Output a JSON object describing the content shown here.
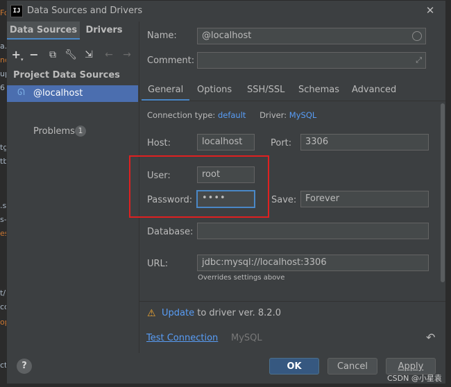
{
  "window": {
    "title": "Data Sources and Drivers",
    "app_icon_text": "IJ"
  },
  "left": {
    "tabs": [
      "Data Sources",
      "Drivers"
    ],
    "section_title": "Project Data Sources",
    "datasource": "@localhost",
    "problems_label": "Problems",
    "problems_count": "1"
  },
  "form": {
    "name_label": "Name:",
    "name_value": "@localhost",
    "comment_label": "Comment:",
    "comment_value": "",
    "tabs": [
      "General",
      "Options",
      "SSH/SSL",
      "Schemas",
      "Advanced"
    ],
    "connection_type_label": "Connection type:",
    "connection_type_value": "default",
    "driver_label": "Driver:",
    "driver_value": "MySQL",
    "host_label": "Host:",
    "host_value": "localhost",
    "port_label": "Port:",
    "port_value": "3306",
    "user_label": "User:",
    "user_value": "root",
    "password_label": "Password:",
    "password_value": "••••",
    "save_label": "Save:",
    "save_value": "Forever",
    "database_label": "Database:",
    "database_value": "",
    "url_label": "URL:",
    "url_value": "jdbc:mysql://localhost:3306",
    "url_hint": "Overrides settings above"
  },
  "warning": {
    "update_link": "Update",
    "text": "to driver ver. 8.2.0"
  },
  "footer": {
    "test_connection": "Test Connection",
    "driver_name": "MySQL"
  },
  "buttons": {
    "ok": "OK",
    "cancel": "Cancel",
    "apply": "Apply"
  },
  "watermark": "CSDN @小星袁",
  "colors": {
    "accent": "#4a88c7",
    "selection": "#4b6eaf",
    "link": "#589df6",
    "annotation": "#e02020",
    "warning": "#f0a732"
  }
}
